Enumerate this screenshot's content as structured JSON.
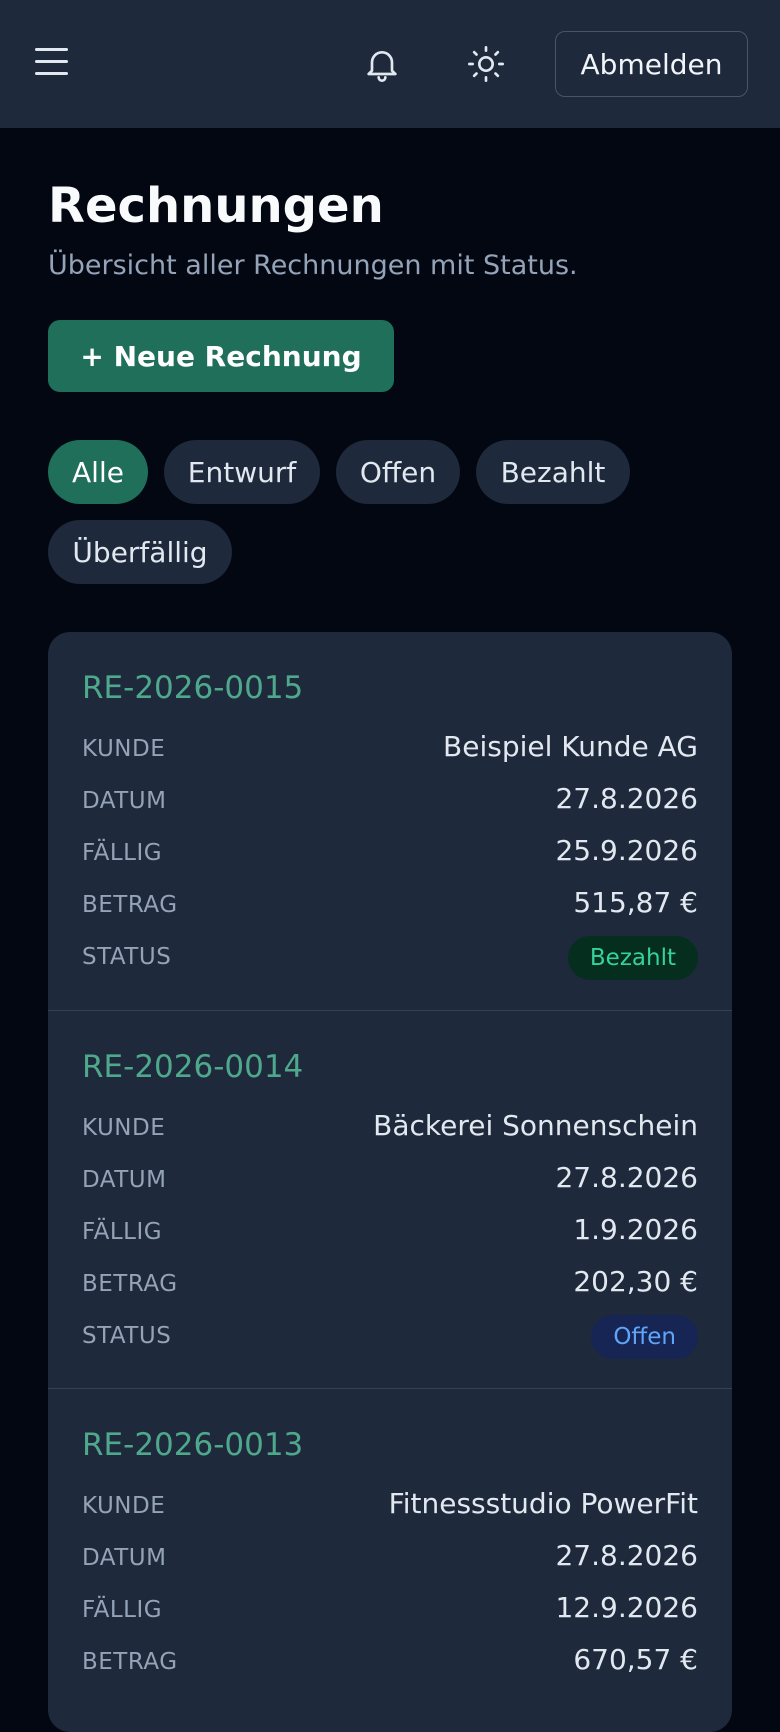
{
  "header": {
    "menu_icon": "hamburger-menu-icon",
    "notification_icon": "bell-icon",
    "theme_icon": "sun-icon",
    "logout_label": "Abmelden"
  },
  "page": {
    "title": "Rechnungen",
    "subtitle": "Übersicht aller Rechnungen mit Status.",
    "new_button_label": "+ Neue Rechnung"
  },
  "filters": {
    "active": "Alle",
    "items": [
      "Alle",
      "Entwurf",
      "Offen",
      "Bezahlt",
      "Überfällig"
    ]
  },
  "labels": {
    "customer": "KUNDE",
    "date": "DATUM",
    "due": "FÄLLIG",
    "amount": "BETRAG",
    "status": "STATUS"
  },
  "invoices": [
    {
      "number": "RE-2026-0015",
      "customer": "Beispiel Kunde AG",
      "date": "27.8.2026",
      "due": "25.9.2026",
      "amount": "515,87 €",
      "status": "Bezahlt",
      "status_color": "#34d399"
    },
    {
      "number": "RE-2026-0014",
      "customer": "Bäckerei Sonnenschein",
      "date": "27.8.2026",
      "due": "1.9.2026",
      "amount": "202,30 €",
      "status": "Offen",
      "status_color": "#60a5fa"
    },
    {
      "number": "RE-2026-0013",
      "customer": "Fitnessstudio PowerFit",
      "date": "27.8.2026",
      "due": "12.9.2026",
      "amount": "670,57 €"
    }
  ],
  "colors": {
    "accent": "#1f6f5b",
    "invoice_number": "#4ea88c",
    "surface": "#1e293b",
    "background": "#030712"
  }
}
